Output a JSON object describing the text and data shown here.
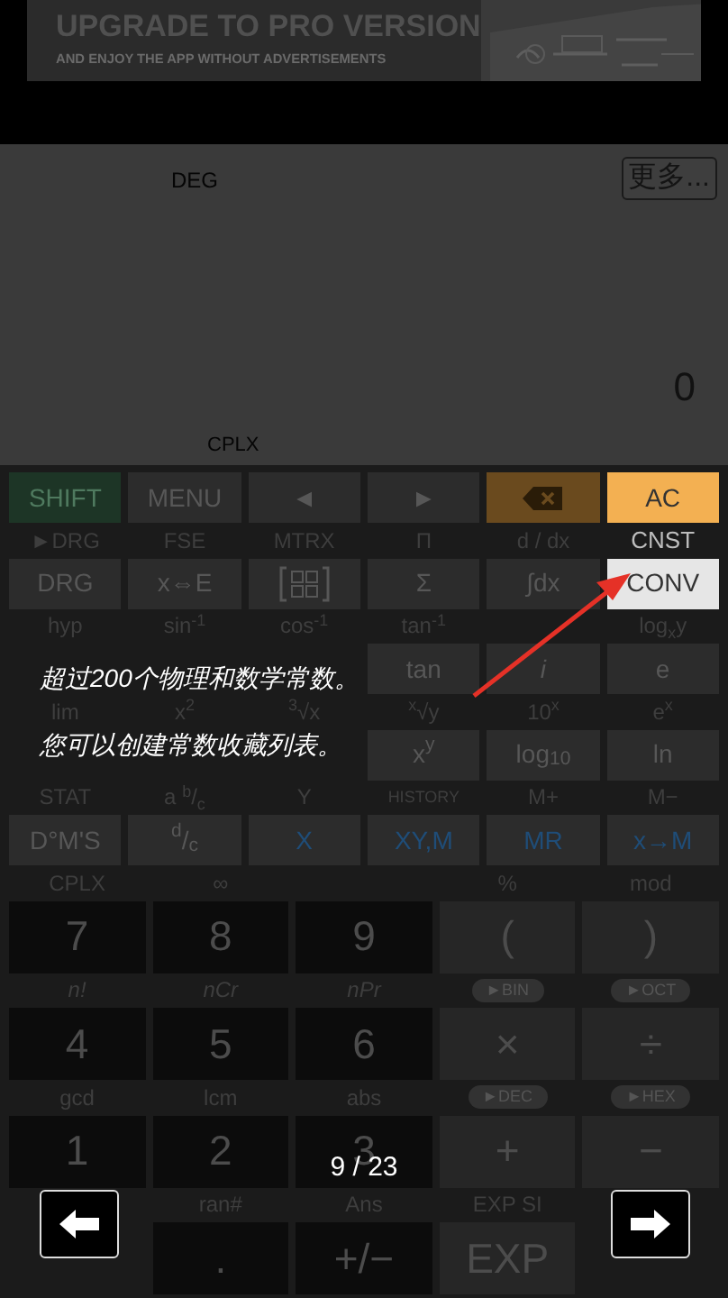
{
  "ad_banner": {
    "title": "UPGRADE TO PRO VERSION",
    "subtitle": "AND ENJOY THE APP WITHOUT ADVERTISEMENTS"
  },
  "display": {
    "angle_mode": "DEG",
    "more_button": "更多...",
    "value": "0",
    "mode": "CPLX"
  },
  "keypad": [
    {
      "kind": "keys",
      "items": [
        {
          "text": "SHIFT",
          "kind": "shift"
        },
        {
          "text": "MENU",
          "kind": "fn"
        },
        {
          "text": "◄",
          "kind": "fn"
        },
        {
          "text": "►",
          "kind": "fn"
        },
        {
          "kind": "backspace"
        },
        {
          "text": "AC",
          "kind": "clear"
        }
      ]
    },
    {
      "kind": "labels",
      "items": [
        {
          "text": "►DRG",
          "kind": "plain"
        },
        {
          "text": "FSE",
          "kind": "plain"
        },
        {
          "text": "MTRX",
          "kind": "plain"
        },
        {
          "text": "Π",
          "kind": "plain"
        },
        {
          "text": "d / dx",
          "kind": "plain"
        },
        {
          "text": "CNST",
          "kind": "lit"
        }
      ]
    },
    {
      "kind": "keys",
      "items": [
        {
          "text": "DRG",
          "kind": "fn"
        },
        {
          "text": "x⇔E",
          "kind": "fn"
        },
        {
          "kind": "matrix"
        },
        {
          "text": "Σ",
          "kind": "fn"
        },
        {
          "text": "∫dx",
          "kind": "fn"
        },
        {
          "text": "CONV",
          "kind": "lit"
        }
      ]
    },
    {
      "kind": "labels",
      "items": [
        {
          "text": "hyp",
          "kind": "plain"
        },
        {
          "text": "sin$^{-1}$",
          "kind": "plain"
        },
        {
          "text": "cos$^{-1}$",
          "kind": "plain"
        },
        {
          "text": "tan$^{-1}$",
          "kind": "plain"
        },
        {
          "kind": "blank"
        },
        {
          "text": "log$_{x}$y",
          "kind": "plain"
        }
      ]
    },
    {
      "kind": "keys",
      "items": [
        {
          "kind": "covered"
        },
        {
          "kind": "covered"
        },
        {
          "kind": "covered"
        },
        {
          "text": "tan",
          "kind": "fn"
        },
        {
          "text": "i",
          "kind": "var"
        },
        {
          "text": "e",
          "kind": "fn"
        }
      ]
    },
    {
      "kind": "labels",
      "items": [
        {
          "text": "lim",
          "kind": "plain"
        },
        {
          "text": "x$^{2}$",
          "kind": "plain"
        },
        {
          "text": "$^{3}$√x",
          "kind": "plain"
        },
        {
          "text": "$^{x}$√y",
          "kind": "plain"
        },
        {
          "text": "10$^{x}$",
          "kind": "plain"
        },
        {
          "text": "e$^{x}$",
          "kind": "plain"
        }
      ]
    },
    {
      "kind": "keys",
      "items": [
        {
          "kind": "covered"
        },
        {
          "kind": "covered"
        },
        {
          "kind": "covered"
        },
        {
          "text": "x$^{y}$",
          "kind": "fn"
        },
        {
          "text": "log$_{10}$",
          "kind": "fn"
        },
        {
          "text": "ln",
          "kind": "fn"
        }
      ]
    },
    {
      "kind": "labels",
      "items": [
        {
          "text": "STAT",
          "kind": "plain"
        },
        {
          "text": "a $^{b}$/$_{c}$",
          "kind": "plain"
        },
        {
          "text": "Y",
          "kind": "plain"
        },
        {
          "text": "HISTORY",
          "kind": "small"
        },
        {
          "text": "M+",
          "kind": "plain"
        },
        {
          "text": "M−",
          "kind": "plain"
        }
      ]
    },
    {
      "kind": "keys",
      "items": [
        {
          "text": "D°M'S",
          "kind": "fn"
        },
        {
          "text": "$^{d}$/$_{c}$",
          "kind": "fn"
        },
        {
          "text": "X",
          "kind": "memory"
        },
        {
          "text": "XY,M",
          "kind": "memory"
        },
        {
          "text": "MR",
          "kind": "memory"
        },
        {
          "text": "x→M",
          "kind": "memory"
        }
      ]
    },
    {
      "kind": "labels",
      "items": [
        {
          "text": "CPLX",
          "kind": "plain"
        },
        {
          "text": "∞",
          "kind": "plain"
        },
        {
          "kind": "blank"
        },
        {
          "text": "%",
          "kind": "plain"
        },
        {
          "text": "mod",
          "kind": "plain"
        }
      ]
    },
    {
      "kind": "keys",
      "items": [
        {
          "text": "7",
          "kind": "digit"
        },
        {
          "text": "8",
          "kind": "digit"
        },
        {
          "text": "9",
          "kind": "digit"
        },
        {
          "text": "(",
          "kind": "op"
        },
        {
          "text": ")",
          "kind": "op"
        }
      ]
    },
    {
      "kind": "labels",
      "items": [
        {
          "text": "n!",
          "kind": "italic"
        },
        {
          "text": "nCr",
          "kind": "italic"
        },
        {
          "text": "nPr",
          "kind": "italic"
        },
        {
          "text": "►BIN",
          "kind": "pill"
        },
        {
          "text": "►OCT",
          "kind": "pill"
        }
      ]
    },
    {
      "kind": "keys",
      "items": [
        {
          "text": "4",
          "kind": "digit"
        },
        {
          "text": "5",
          "kind": "digit"
        },
        {
          "text": "6",
          "kind": "digit"
        },
        {
          "text": "×",
          "kind": "op"
        },
        {
          "text": "÷",
          "kind": "op"
        }
      ]
    },
    {
      "kind": "labels",
      "items": [
        {
          "text": "gcd",
          "kind": "plain"
        },
        {
          "text": "lcm",
          "kind": "plain"
        },
        {
          "text": "abs",
          "kind": "plain"
        },
        {
          "text": "►DEC",
          "kind": "pill"
        },
        {
          "text": "►HEX",
          "kind": "pill"
        }
      ]
    },
    {
      "kind": "keys",
      "items": [
        {
          "text": "1",
          "kind": "digit"
        },
        {
          "text": "2",
          "kind": "digit"
        },
        {
          "text": "3",
          "kind": "digit"
        },
        {
          "text": "+",
          "kind": "op"
        },
        {
          "text": "−",
          "kind": "op"
        }
      ]
    },
    {
      "kind": "labels",
      "items": [
        {
          "kind": "blank"
        },
        {
          "text": "ran#",
          "kind": "plain"
        },
        {
          "text": "Ans",
          "kind": "plain"
        },
        {
          "text": "EXP SI",
          "kind": "plain"
        },
        {
          "kind": "blank"
        }
      ]
    },
    {
      "kind": "keys",
      "items": [
        {
          "kind": "covered"
        },
        {
          "text": ".",
          "kind": "digit"
        },
        {
          "text": "+/−",
          "kind": "digit"
        },
        {
          "text": "EXP",
          "kind": "op"
        },
        {
          "kind": "covered"
        }
      ]
    }
  ],
  "tutorial": {
    "lines": [
      "超过200个物理和数学常数。",
      "您可以创建常数收藏列表。"
    ],
    "page": "9 / 23"
  }
}
